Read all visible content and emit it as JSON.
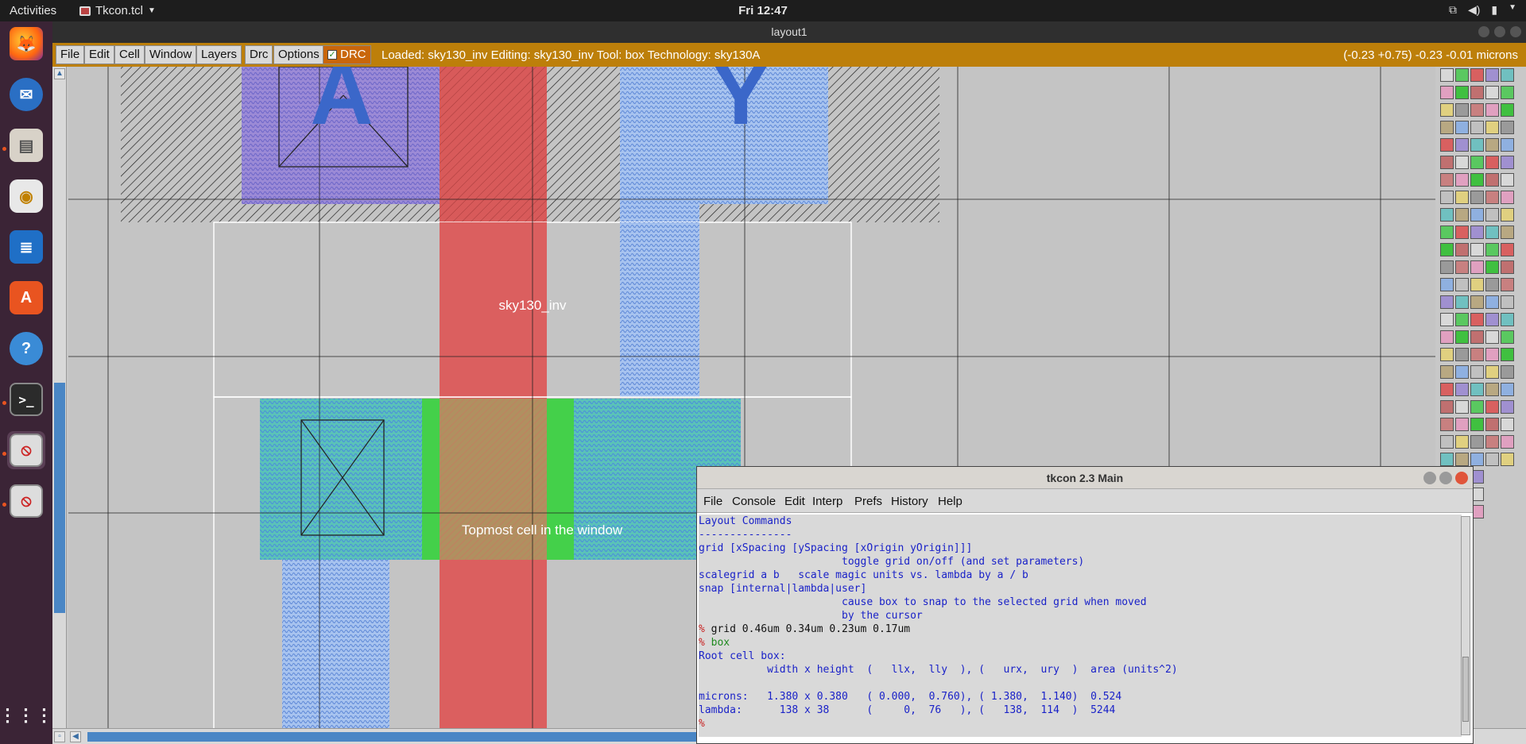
{
  "topbar": {
    "activities": "Activities",
    "app_name": "Tkcon.tcl",
    "clock": "Fri 12:47",
    "tray_icons": [
      "network-icon",
      "volume-icon",
      "power-icon"
    ]
  },
  "dock": {
    "items": [
      "firefox-icon",
      "thunderbird-icon",
      "files-icon",
      "rhythmbox-icon",
      "writer-icon",
      "software-icon",
      "help-icon",
      "terminal-icon",
      "app-icon-1",
      "app-icon-2",
      "show-apps-icon"
    ]
  },
  "magic": {
    "window_title": "layout1",
    "menus": [
      "File",
      "Edit",
      "Cell",
      "Window",
      "Layers",
      "Drc",
      "Options"
    ],
    "drc_label": "DRC",
    "status": "Loaded: sky130_inv Editing: sky130_inv Tool: box  Technology: sky130A",
    "coords": "(-0.23 +0.75) -0.23 -0.01 microns",
    "labels": {
      "port_a": "A",
      "port_y": "Y",
      "cell_name": "sky130_inv",
      "topmost": "Topmost cell in the window"
    }
  },
  "tkcon": {
    "title": "tkcon 2.3 Main",
    "menus": [
      "File",
      "Console",
      "Edit",
      "Interp",
      "Prefs",
      "History",
      "Help"
    ],
    "lines": [
      {
        "text": "Layout Commands",
        "color": "blue"
      },
      {
        "text": "---------------",
        "color": "blue"
      },
      {
        "text": "grid [xSpacing [ySpacing [xOrigin yOrigin]]]",
        "color": "blue"
      },
      {
        "text": "                       toggle grid on/off (and set parameters)",
        "color": "blue"
      },
      {
        "text": "scalegrid a b   scale magic units vs. lambda by a / b",
        "color": "blue"
      },
      {
        "text": "snap [internal|lambda|user]",
        "color": "blue"
      },
      {
        "text": "                       cause box to snap to the selected grid when moved",
        "color": "blue"
      },
      {
        "text": "                       by the cursor",
        "color": "blue"
      },
      {
        "prompt": "% ",
        "text": "grid 0.46um 0.34um 0.23um 0.17um",
        "color": "black"
      },
      {
        "prompt": "% ",
        "text": "box",
        "color": "green"
      },
      {
        "text": "Root cell box:",
        "color": "blue"
      },
      {
        "text": "           width x height  (   llx,  lly  ), (   urx,  ury  )  area (units^2)",
        "color": "blue"
      },
      {
        "text": "",
        "color": "blue"
      },
      {
        "text": "microns:   1.380 x 0.380   ( 0.000,  0.760), ( 1.380,  1.140)  0.524",
        "color": "blue"
      },
      {
        "text": "lambda:      138 x 38      (     0,  76   ), (   138,  114  )  5244",
        "color": "blue"
      },
      {
        "prompt": "% ",
        "text": "",
        "color": "black"
      }
    ]
  }
}
